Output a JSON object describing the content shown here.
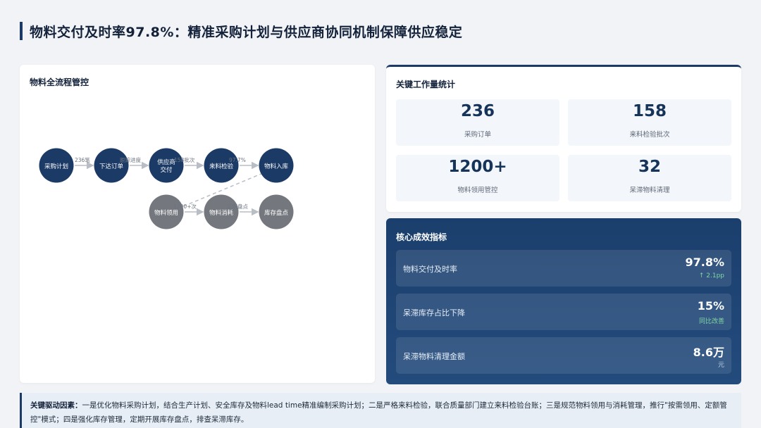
{
  "page": {
    "title": "物料交付及时率97.8%：精准采购计划与供应商协同机制保障供应稳定"
  },
  "flow": {
    "title": "物料全流程管控",
    "nodes": [
      {
        "label": "采购计划",
        "type": "main"
      },
      {
        "label": "下达订单",
        "type": "main"
      },
      {
        "label": "供应商交付",
        "line1": "供应商",
        "line2": "交付",
        "type": "main"
      },
      {
        "label": "来料检验",
        "type": "main"
      },
      {
        "label": "物料入库",
        "type": "main"
      },
      {
        "label": "物料领用",
        "type": "sub"
      },
      {
        "label": "物料消耗",
        "type": "sub"
      },
      {
        "label": "库存盘点",
        "type": "sub"
      }
    ],
    "edge_labels": [
      "236笔",
      "跟踪进度",
      "158批次",
      "97.7%",
      "1200+次",
      "定期盘点"
    ]
  },
  "stats": {
    "title": "关键工作量统计",
    "items": [
      {
        "value": "236",
        "label": "采购订单"
      },
      {
        "value": "158",
        "label": "来料检验批次"
      },
      {
        "value": "1200+",
        "label": "物料领用管控"
      },
      {
        "value": "32",
        "label": "呆滞物料清理"
      }
    ]
  },
  "kpi": {
    "title": "核心成效指标",
    "items": [
      {
        "label": "物料交付及时率",
        "value": "97.8%",
        "sub": "↑ 2.1pp"
      },
      {
        "label": "呆滞库存占比下降",
        "value": "15%",
        "sub": "同比改善"
      },
      {
        "label": "呆滞物料清理金额",
        "value": "8.6万",
        "sub": "元"
      }
    ]
  },
  "footer": {
    "heading": "关键驱动因素：",
    "text": "一是优化物料采购计划，结合生产计划、安全库存及物料lead time精准编制采购计划；二是严格来料检验，联合质量部门建立来料检验台账；三是规范物料领用与消耗管理，推行\"按需领用、定额管控\"模式；四是强化库存管理，定期开展库存盘点，排查呆滞库存。"
  },
  "colors": {
    "primary": "#1b3a66",
    "node_main": "#1b3a66",
    "node_sub": "#74787e",
    "kpi_sub_up": "#7fd6a4",
    "kpi_sub_muted": "#bcd0e6"
  }
}
